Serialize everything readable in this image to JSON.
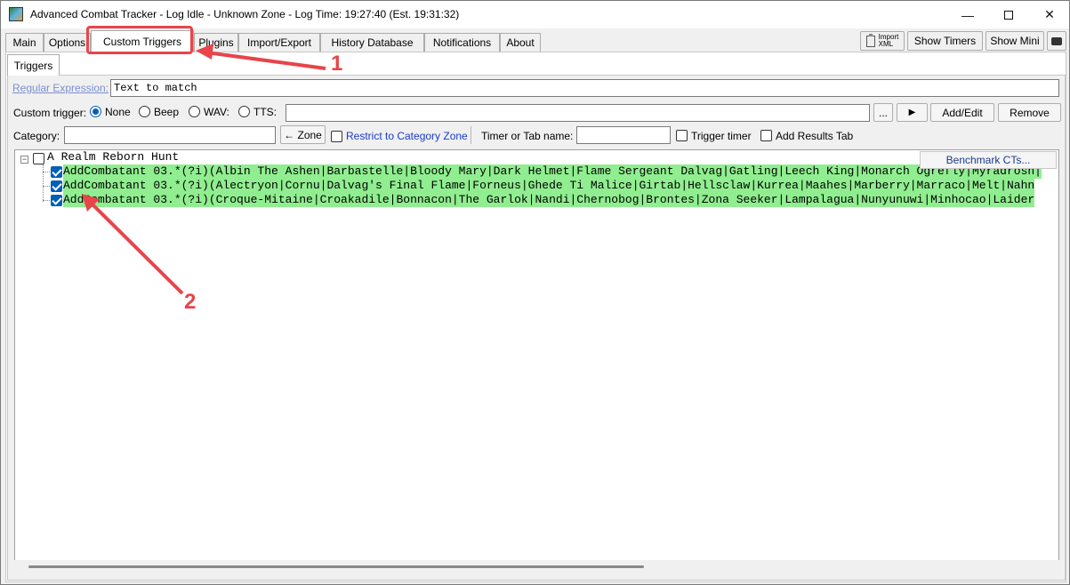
{
  "window": {
    "title": "Advanced Combat Tracker - Log Idle - Unknown Zone - Log Time: 19:27:40 (Est. 19:31:32)",
    "minimize": "—",
    "close": "✕"
  },
  "tabs": [
    {
      "label": "Main"
    },
    {
      "label": "Options"
    },
    {
      "label": "Custom Triggers",
      "active": true
    },
    {
      "label": "Plugins"
    },
    {
      "label": "Import/Export"
    },
    {
      "label": "History Database"
    },
    {
      "label": "Notifications"
    },
    {
      "label": "About"
    }
  ],
  "right_buttons": {
    "import_xml_line1": "Import",
    "import_xml_line2": "XML",
    "show_timers": "Show Timers",
    "show_mini": "Show Mini"
  },
  "subtabs": {
    "triggers": "Triggers"
  },
  "form": {
    "regex_label": "Regular Expression:",
    "regex_value": "Text to match",
    "custom_trigger_label": "Custom trigger:",
    "radio_options": [
      "None",
      "Beep",
      "WAV:",
      "TTS:"
    ],
    "radio_selected": "None",
    "custom_trigger_value": "",
    "ellipsis_button": "...",
    "play_button": "▶",
    "add_edit_button": "Add/Edit",
    "remove_button": "Remove",
    "category_label": "Category:",
    "category_value": "",
    "zone_button": "← Zone",
    "restrict_label": "Restrict to Category Zone",
    "timer_label": "Timer or Tab name:",
    "timer_value": "",
    "trigger_timer_label": "Trigger timer",
    "add_results_label": "Add Results Tab"
  },
  "tree": {
    "benchmark_button": "Benchmark CTs...",
    "category": "A Realm Reborn Hunt",
    "category_checked": false,
    "items": [
      {
        "text": "AddCombatant 03.*(?i)(Albin The Ashen|Barbastelle|Bloody Mary|Dark Helmet|Flame Sergeant Dalvag|Gatling|Leech King|Monarch Ogrefly|Myradrosh|",
        "checked": true
      },
      {
        "text": "AddCombatant 03.*(?i)(Alectryon|Cornu|Dalvag's Final Flame|Forneus|Ghede Ti Malice|Girtab|Hellsclaw|Kurrea|Maahes|Marberry|Marraco|Melt|Nahn",
        "checked": true
      },
      {
        "text": "AddCombatant 03.*(?i)(Croque-Mitaine|Croakadile|Bonnacon|The Garlok|Nandi|Chernobog|Brontes|Zona Seeker|Lampalagua|Nunyunuwi|Minhocao|Laider",
        "checked": true
      }
    ]
  },
  "annotations": {
    "label_1": "1",
    "label_2": "2",
    "color": "#e8444a"
  },
  "colors": {
    "active_trigger_bg": "#90ee90",
    "accent": "#005fb8"
  }
}
